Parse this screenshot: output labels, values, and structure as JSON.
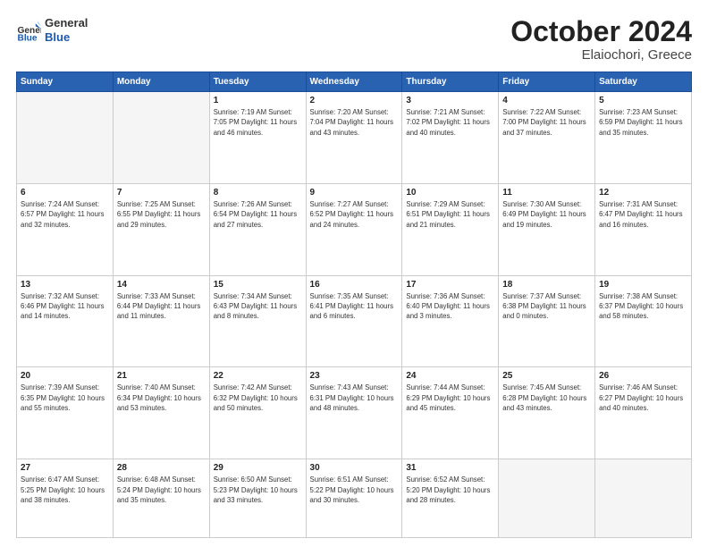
{
  "header": {
    "logo_line1": "General",
    "logo_line2": "Blue",
    "title": "October 2024",
    "subtitle": "Elaiochori, Greece"
  },
  "days_of_week": [
    "Sunday",
    "Monday",
    "Tuesday",
    "Wednesday",
    "Thursday",
    "Friday",
    "Saturday"
  ],
  "weeks": [
    [
      {
        "day": "",
        "info": ""
      },
      {
        "day": "",
        "info": ""
      },
      {
        "day": "1",
        "info": "Sunrise: 7:19 AM\nSunset: 7:05 PM\nDaylight: 11 hours and 46 minutes."
      },
      {
        "day": "2",
        "info": "Sunrise: 7:20 AM\nSunset: 7:04 PM\nDaylight: 11 hours and 43 minutes."
      },
      {
        "day": "3",
        "info": "Sunrise: 7:21 AM\nSunset: 7:02 PM\nDaylight: 11 hours and 40 minutes."
      },
      {
        "day": "4",
        "info": "Sunrise: 7:22 AM\nSunset: 7:00 PM\nDaylight: 11 hours and 37 minutes."
      },
      {
        "day": "5",
        "info": "Sunrise: 7:23 AM\nSunset: 6:59 PM\nDaylight: 11 hours and 35 minutes."
      }
    ],
    [
      {
        "day": "6",
        "info": "Sunrise: 7:24 AM\nSunset: 6:57 PM\nDaylight: 11 hours and 32 minutes."
      },
      {
        "day": "7",
        "info": "Sunrise: 7:25 AM\nSunset: 6:55 PM\nDaylight: 11 hours and 29 minutes."
      },
      {
        "day": "8",
        "info": "Sunrise: 7:26 AM\nSunset: 6:54 PM\nDaylight: 11 hours and 27 minutes."
      },
      {
        "day": "9",
        "info": "Sunrise: 7:27 AM\nSunset: 6:52 PM\nDaylight: 11 hours and 24 minutes."
      },
      {
        "day": "10",
        "info": "Sunrise: 7:29 AM\nSunset: 6:51 PM\nDaylight: 11 hours and 21 minutes."
      },
      {
        "day": "11",
        "info": "Sunrise: 7:30 AM\nSunset: 6:49 PM\nDaylight: 11 hours and 19 minutes."
      },
      {
        "day": "12",
        "info": "Sunrise: 7:31 AM\nSunset: 6:47 PM\nDaylight: 11 hours and 16 minutes."
      }
    ],
    [
      {
        "day": "13",
        "info": "Sunrise: 7:32 AM\nSunset: 6:46 PM\nDaylight: 11 hours and 14 minutes."
      },
      {
        "day": "14",
        "info": "Sunrise: 7:33 AM\nSunset: 6:44 PM\nDaylight: 11 hours and 11 minutes."
      },
      {
        "day": "15",
        "info": "Sunrise: 7:34 AM\nSunset: 6:43 PM\nDaylight: 11 hours and 8 minutes."
      },
      {
        "day": "16",
        "info": "Sunrise: 7:35 AM\nSunset: 6:41 PM\nDaylight: 11 hours and 6 minutes."
      },
      {
        "day": "17",
        "info": "Sunrise: 7:36 AM\nSunset: 6:40 PM\nDaylight: 11 hours and 3 minutes."
      },
      {
        "day": "18",
        "info": "Sunrise: 7:37 AM\nSunset: 6:38 PM\nDaylight: 11 hours and 0 minutes."
      },
      {
        "day": "19",
        "info": "Sunrise: 7:38 AM\nSunset: 6:37 PM\nDaylight: 10 hours and 58 minutes."
      }
    ],
    [
      {
        "day": "20",
        "info": "Sunrise: 7:39 AM\nSunset: 6:35 PM\nDaylight: 10 hours and 55 minutes."
      },
      {
        "day": "21",
        "info": "Sunrise: 7:40 AM\nSunset: 6:34 PM\nDaylight: 10 hours and 53 minutes."
      },
      {
        "day": "22",
        "info": "Sunrise: 7:42 AM\nSunset: 6:32 PM\nDaylight: 10 hours and 50 minutes."
      },
      {
        "day": "23",
        "info": "Sunrise: 7:43 AM\nSunset: 6:31 PM\nDaylight: 10 hours and 48 minutes."
      },
      {
        "day": "24",
        "info": "Sunrise: 7:44 AM\nSunset: 6:29 PM\nDaylight: 10 hours and 45 minutes."
      },
      {
        "day": "25",
        "info": "Sunrise: 7:45 AM\nSunset: 6:28 PM\nDaylight: 10 hours and 43 minutes."
      },
      {
        "day": "26",
        "info": "Sunrise: 7:46 AM\nSunset: 6:27 PM\nDaylight: 10 hours and 40 minutes."
      }
    ],
    [
      {
        "day": "27",
        "info": "Sunrise: 6:47 AM\nSunset: 5:25 PM\nDaylight: 10 hours and 38 minutes."
      },
      {
        "day": "28",
        "info": "Sunrise: 6:48 AM\nSunset: 5:24 PM\nDaylight: 10 hours and 35 minutes."
      },
      {
        "day": "29",
        "info": "Sunrise: 6:50 AM\nSunset: 5:23 PM\nDaylight: 10 hours and 33 minutes."
      },
      {
        "day": "30",
        "info": "Sunrise: 6:51 AM\nSunset: 5:22 PM\nDaylight: 10 hours and 30 minutes."
      },
      {
        "day": "31",
        "info": "Sunrise: 6:52 AM\nSunset: 5:20 PM\nDaylight: 10 hours and 28 minutes."
      },
      {
        "day": "",
        "info": ""
      },
      {
        "day": "",
        "info": ""
      }
    ]
  ]
}
